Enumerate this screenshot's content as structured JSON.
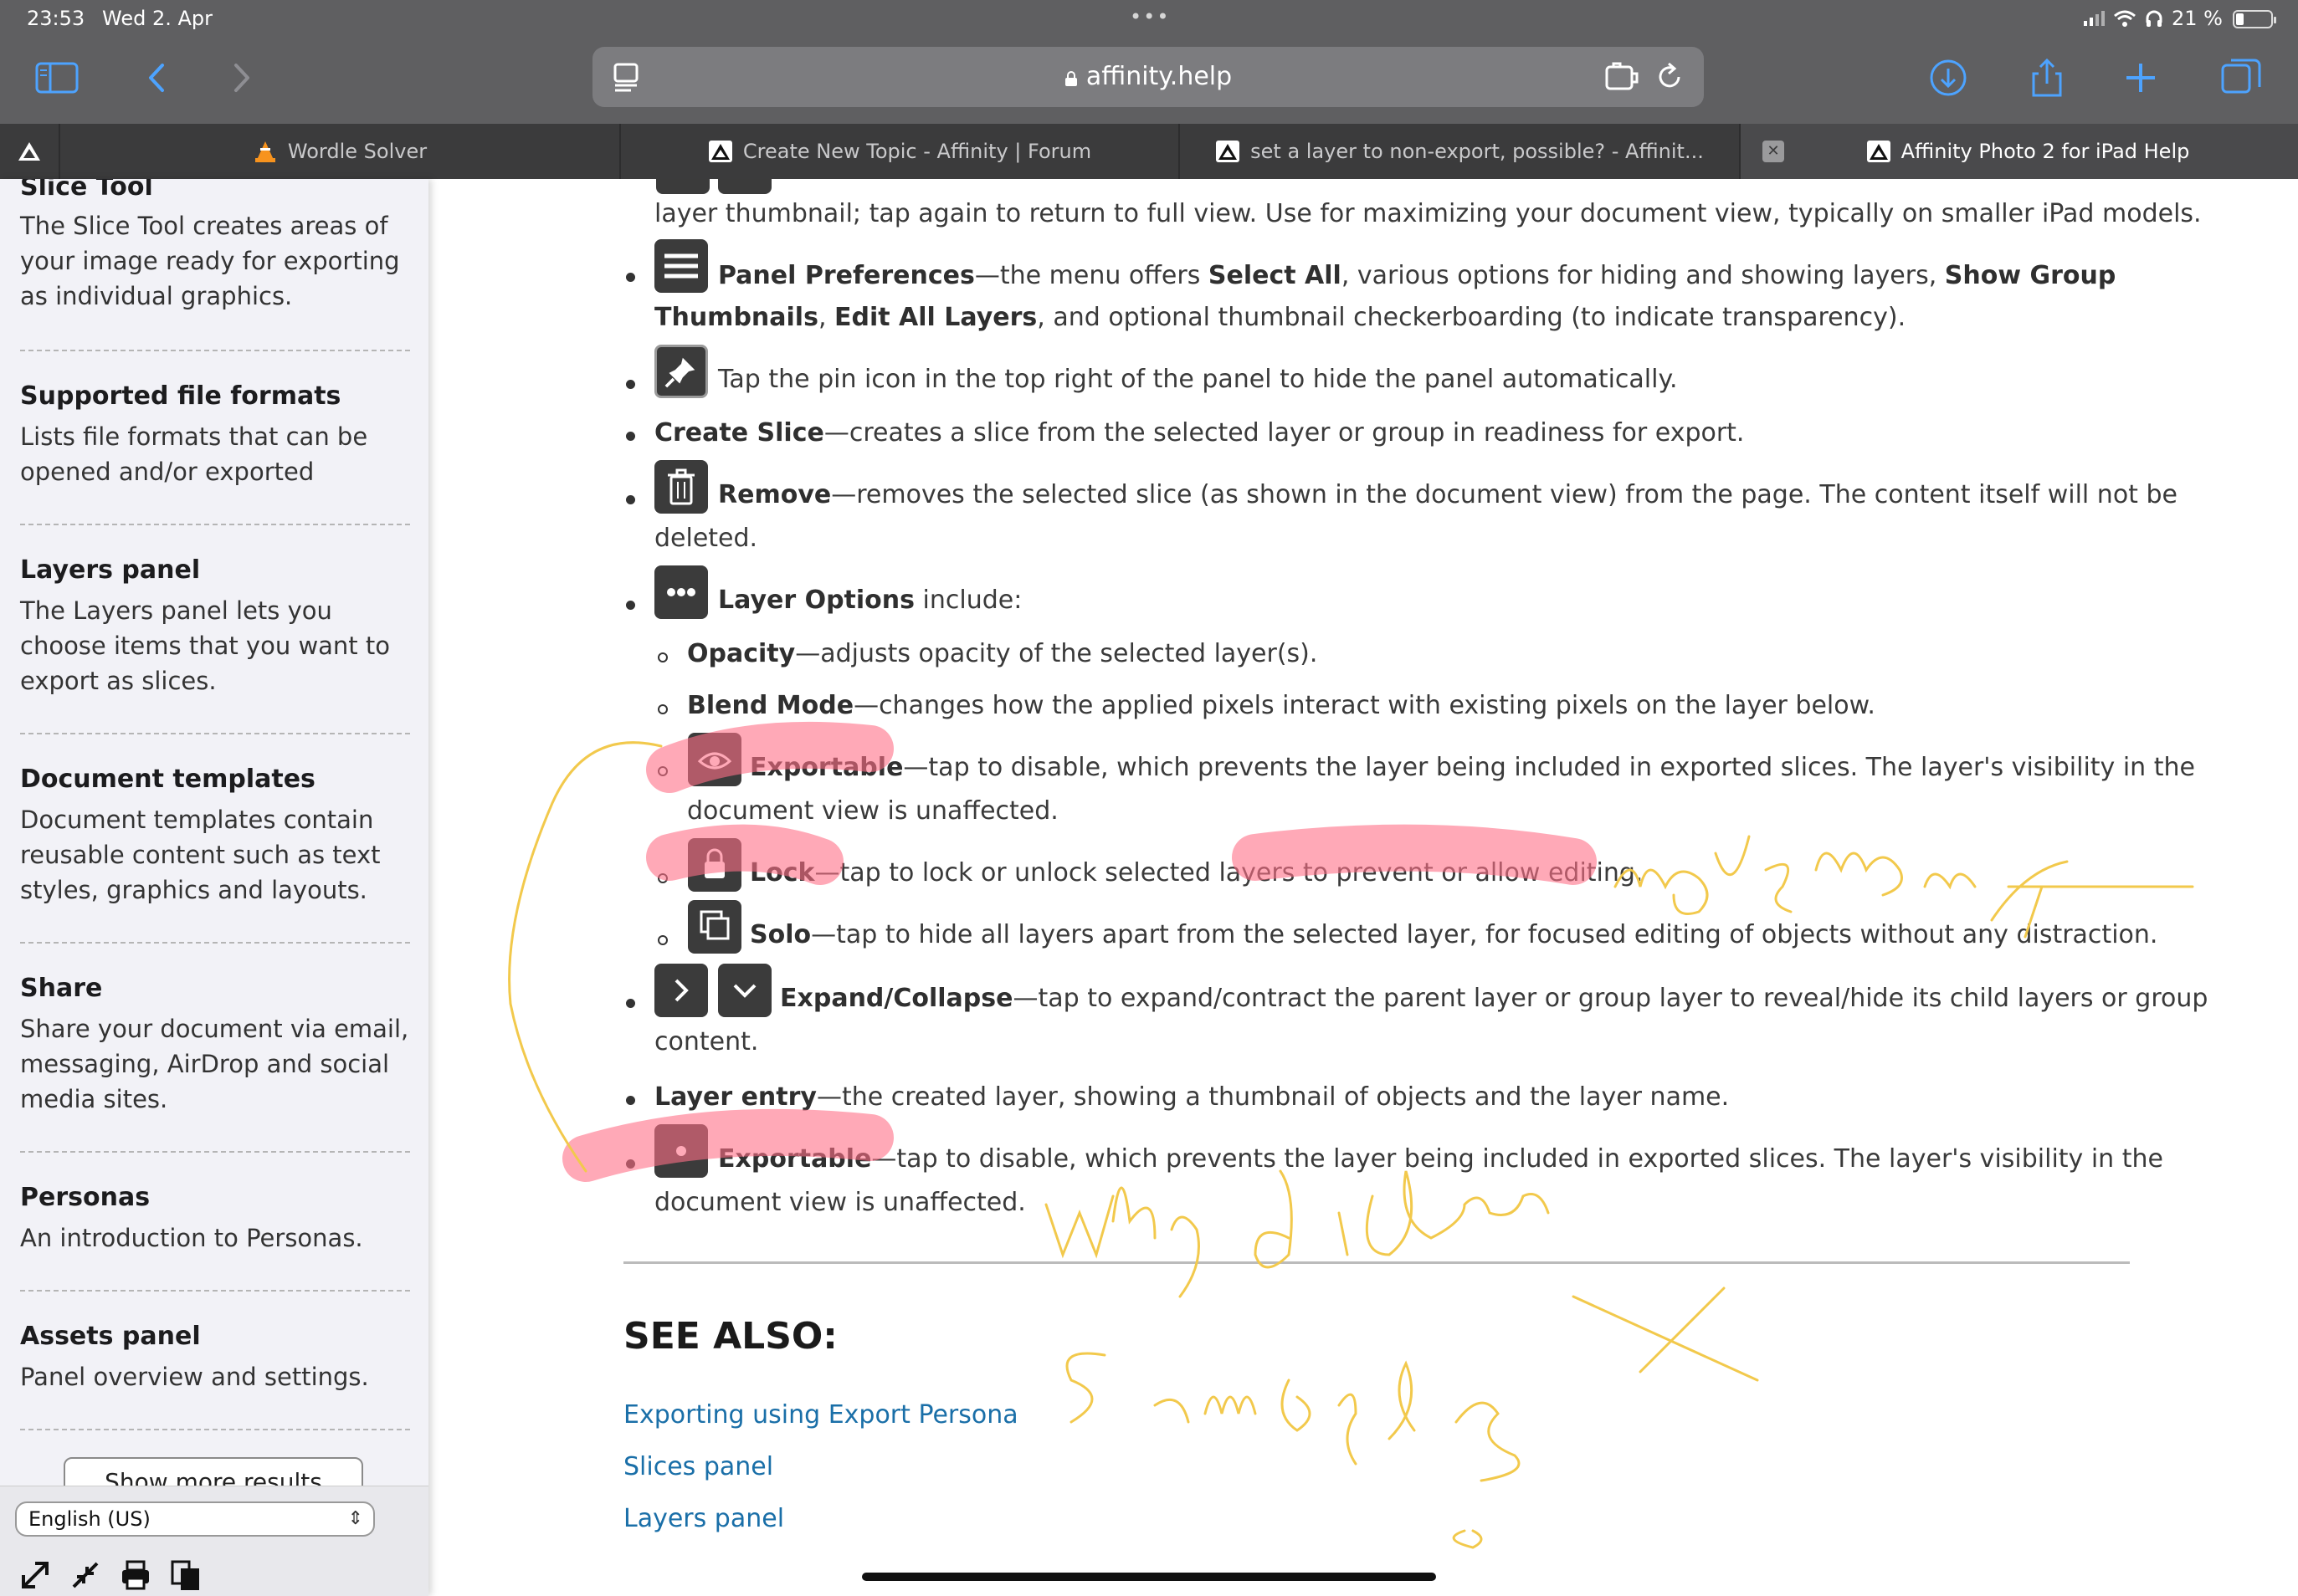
{
  "status": {
    "time": "23:53",
    "date": "Wed 2. Apr",
    "dots": "•••",
    "battery": "21 %"
  },
  "browser": {
    "url": "affinity.help",
    "tabs": [
      {
        "label": "Wordle Solver"
      },
      {
        "label": "Create New Topic - Affinity | Forum"
      },
      {
        "label": "set a layer to non-export, possible? - Affinit..."
      },
      {
        "label": "Affinity Photo 2 for iPad Help"
      }
    ]
  },
  "sidebar": {
    "results": [
      {
        "title": "Slice Tool",
        "desc": "The Slice Tool creates areas of your image ready for exporting as individual graphics."
      },
      {
        "title": "Supported file formats",
        "desc": "Lists file formats that can be opened and/or exported"
      },
      {
        "title": "Layers panel",
        "desc": "The Layers panel lets you choose items that you want to export as slices."
      },
      {
        "title": "Document templates",
        "desc": "Document templates contain reusable content such as text styles, graphics and layouts."
      },
      {
        "title": "Share",
        "desc": "Share your document via email, messaging, AirDrop and social media sites."
      },
      {
        "title": "Personas",
        "desc": "An introduction to Personas."
      },
      {
        "title": "Assets panel",
        "desc": "Panel overview and settings."
      }
    ],
    "show_more": "Show more results",
    "language": "English (US)"
  },
  "content": {
    "l0": "layer thumbnail; tap again to return to full view. Use for maximizing your document view, typically on smaller iPad models.",
    "panel_pref": {
      "b1": "Panel Preferences",
      "t1": "—the menu offers ",
      "b2": "Select All",
      "t2": ", various options for hiding and showing layers, ",
      "b3": "Show Group",
      "b4": "Thumbnails",
      "t3": ", ",
      "b5": "Edit All Layers",
      "t4": ", and optional thumbnail checkerboarding (to indicate transparency)."
    },
    "pin": "Tap the pin icon in the top right of the panel to hide the panel automatically.",
    "create_slice": {
      "b": "Create Slice",
      "t": "—creates a slice from the selected layer or group in readiness for export."
    },
    "remove": {
      "b": "Remove",
      "t": "—removes the selected slice (as shown in the document view) from the page. The content itself will not be",
      "t2": "deleted."
    },
    "layer_opts": {
      "b": "Layer Options",
      "t": " include:"
    },
    "opacity": {
      "b": "Opacity",
      "t": "—adjusts opacity of the selected layer(s)."
    },
    "blend": {
      "b": "Blend Mode",
      "t": "—changes how the applied pixels interact with existing pixels on the layer below."
    },
    "exportable1": {
      "b": "Exportable",
      "t": "—tap to disable, which prevents the layer being included in exported slices. The layer's visibility in the",
      "t2": "document view is unaffected."
    },
    "lock": {
      "b": "Lock",
      "t": "—tap to lock or unlock selected layers to prevent or allow editing."
    },
    "solo": {
      "b": "Solo",
      "t": "—tap to hide all layers apart from the selected layer, for focused editing of objects without any distraction."
    },
    "expand": {
      "b": "Expand/Collapse",
      "t": "—tap to expand/contract the parent layer or group layer to reveal/hide its child layers or group",
      "t2": "content."
    },
    "layer_entry": {
      "b": "Layer entry",
      "t": "—the created layer, showing a thumbnail of objects and the layer name."
    },
    "exportable2": {
      "b": "Exportable",
      "t": "—tap to disable, which prevents the layer being included in exported slices. The layer's visibility in the",
      "t2": "document view is unaffected."
    },
    "see_also": "SEE ALSO:",
    "links": [
      "Exporting using Export Persona",
      "Slices panel",
      "Layers panel"
    ]
  },
  "colors": {
    "chrome": "#5f5f61",
    "tabbar": "#3b3b3c",
    "accent": "#4da3ff",
    "link": "#1a6fa8",
    "highlight": "#ff6f87",
    "ink": "#f2c94c"
  }
}
